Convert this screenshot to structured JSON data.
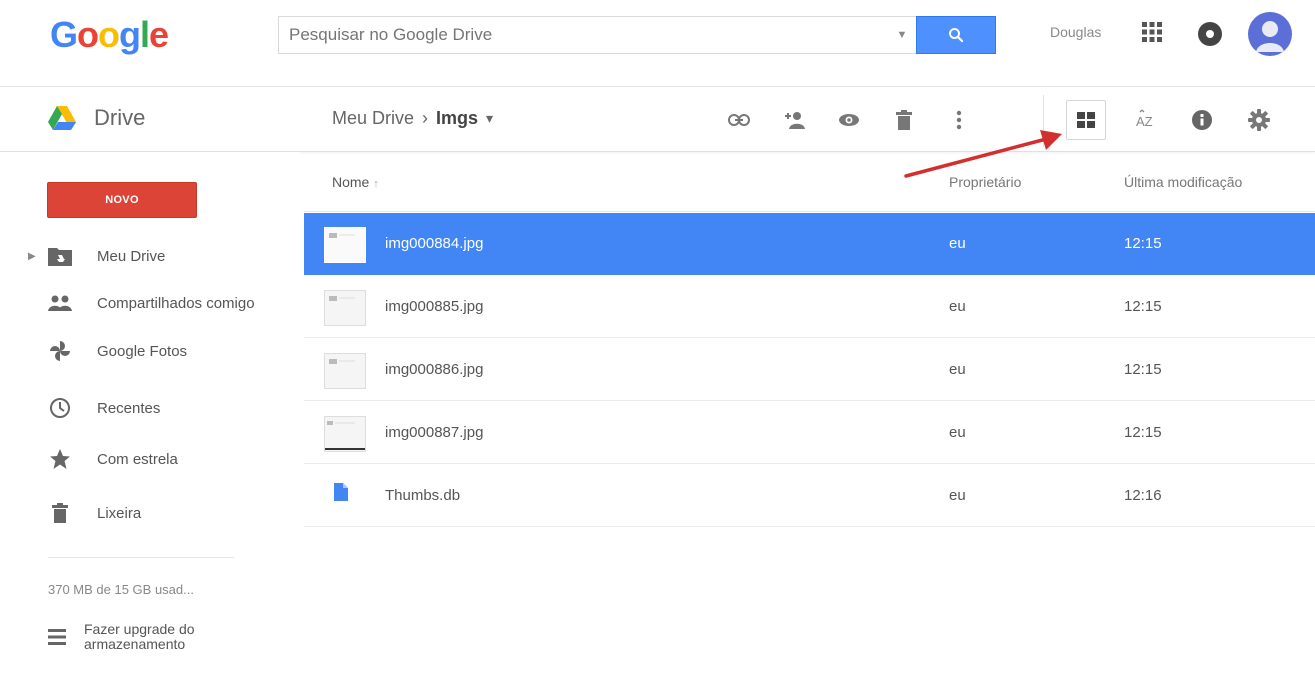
{
  "header": {
    "logo_letters": [
      {
        "ch": "G",
        "color": "#4285f4"
      },
      {
        "ch": "o",
        "color": "#ea4335"
      },
      {
        "ch": "o",
        "color": "#fbbc05"
      },
      {
        "ch": "g",
        "color": "#4285f4"
      },
      {
        "ch": "l",
        "color": "#34a853"
      },
      {
        "ch": "e",
        "color": "#ea4335"
      }
    ],
    "search_placeholder": "Pesquisar no Google Drive",
    "user_name": "Douglas"
  },
  "subbar": {
    "brand_label": "Drive",
    "breadcrumb_root": "Meu Drive",
    "breadcrumb_sep": "›",
    "breadcrumb_current": "Imgs",
    "breadcrumb_dropdown": "▾",
    "tools_left": [
      "link-icon",
      "share-person-icon",
      "preview-eye-icon",
      "trash-icon",
      "more-vert-icon"
    ],
    "tools_right": [
      "grid-view-icon",
      "sort-az-icon",
      "info-icon",
      "settings-gear-icon"
    ]
  },
  "sidebar": {
    "new_label": "NOVO",
    "items": [
      {
        "label": "Meu Drive",
        "icon": "my-drive-folder-icon",
        "expandable": true
      },
      {
        "label": "Compartilhados comigo",
        "icon": "shared-people-icon",
        "expandable": false
      },
      {
        "label": "Google Fotos",
        "icon": "pinwheel-photos-icon",
        "expandable": false
      },
      {
        "label": "Recentes",
        "icon": "clock-icon",
        "expandable": false
      },
      {
        "label": "Com estrela",
        "icon": "star-icon",
        "expandable": false
      },
      {
        "label": "Lixeira",
        "icon": "trash-icon",
        "expandable": false
      }
    ],
    "storage_text": "370 MB de 15 GB usad...",
    "upgrade_line1": "Fazer upgrade do",
    "upgrade_line2": "armazenamento"
  },
  "list": {
    "columns": {
      "name": "Nome",
      "sort_arrow": "↑",
      "owner": "Proprietário",
      "modified": "Última modificação"
    },
    "rows": [
      {
        "name": "img000884.jpg",
        "owner": "eu",
        "modified": "12:15",
        "selected": true,
        "kind": "image"
      },
      {
        "name": "img000885.jpg",
        "owner": "eu",
        "modified": "12:15",
        "selected": false,
        "kind": "image"
      },
      {
        "name": "img000886.jpg",
        "owner": "eu",
        "modified": "12:15",
        "selected": false,
        "kind": "image"
      },
      {
        "name": "img000887.jpg",
        "owner": "eu",
        "modified": "12:15",
        "selected": false,
        "kind": "image"
      },
      {
        "name": "Thumbs.db",
        "owner": "eu",
        "modified": "12:16",
        "selected": false,
        "kind": "doc"
      }
    ]
  },
  "colors": {
    "accent_blue": "#4285f4",
    "new_red": "#db4437",
    "search_blue": "#4d90fe",
    "annotation_arrow": "#d32f2f"
  }
}
